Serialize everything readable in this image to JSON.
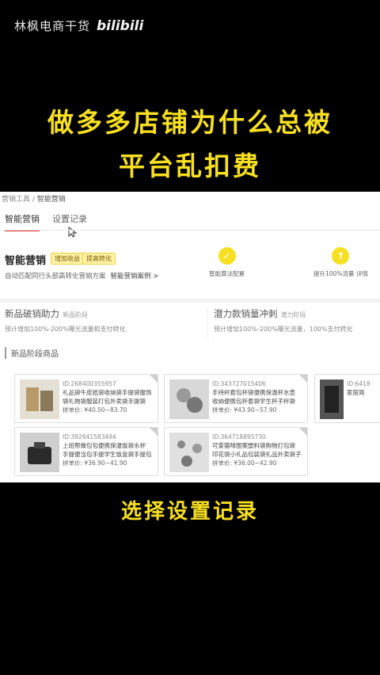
{
  "watermark": {
    "channel": "林枫电商干货",
    "logo": "bilibili"
  },
  "headline": {
    "line1": "做多多店铺为什么总被",
    "line2": "平台乱扣费"
  },
  "screen": {
    "breadcrumb": {
      "parent": "营销工具",
      "current": "智能营销"
    },
    "tabs": [
      {
        "label": "智能营销"
      },
      {
        "label": "设置记录"
      }
    ],
    "banner": {
      "title": "智能营销",
      "tags": [
        "增加收益",
        "提高转化"
      ],
      "desc": "自动匹配同行头部高转化营销方案",
      "desc_link": "智能营销案例 >",
      "features": [
        {
          "icon": "check-badge-icon",
          "label": "智能算法配置"
        },
        {
          "icon": "up-arrow-icon",
          "label": "提升100%流量 详情"
        }
      ]
    },
    "promos": [
      {
        "title": "新品破销助力",
        "sub": "新品阶段",
        "desc": "预计增加100%-200%曝光流量和支付转化"
      },
      {
        "title": "潜力款销量冲刺",
        "sub": "潜力阶段",
        "desc": "预计增加100%-200%曝光流量，100%支付转化"
      }
    ],
    "section_title": "新品阶段商品",
    "products": [
      {
        "id": "ID:268400355957",
        "name": "礼品袋牛皮纸袋收纳袋手提袋服饰",
        "name2": "袋礼物袋服装打包外卖袋手提袋",
        "price": "拼单价: ¥40.50~83.70"
      },
      {
        "id": "ID:343727015406",
        "name": "手持杯套包杯袋便携保温杯水壶",
        "name2": "收纳便携包杯套袋学生杯子杯袋",
        "price": "拼单价: ¥43.90~57.90"
      },
      {
        "id": "ID:6418",
        "name": "家居简",
        "name2": "",
        "price": ""
      },
      {
        "id": "ID:392641583494",
        "name": "上班帮做包包便携保温饭袋水杯",
        "name2": "手提便当包手提学生饭盒袋手提包",
        "price": "拼单价: ¥36.90~41.90"
      },
      {
        "id": "ID:364718895730",
        "name": "可爱猫咪图案塑料袋购物打包袋",
        "name2": "印花袋小礼品包装袋礼品外卖袋子",
        "price": "拼单价: ¥36.00~42.90"
      }
    ]
  },
  "caption": "选择设置记录",
  "colors": {
    "headline": "#f7e021",
    "accent_red": "#e02e24",
    "tag_bg": "#fff2a6"
  }
}
